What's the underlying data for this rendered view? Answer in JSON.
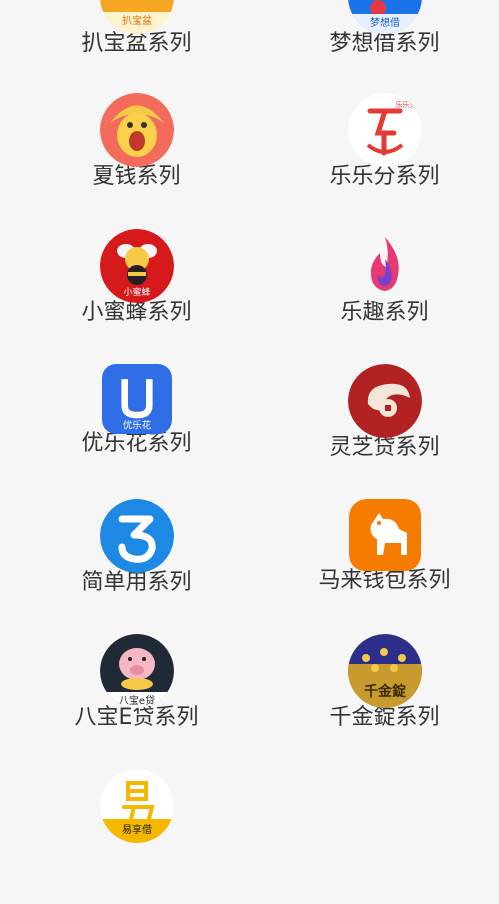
{
  "items": [
    {
      "label": "扒宝盆系列",
      "icon": "pabaopen-logo-icon",
      "icon_text": "扒宝盆"
    },
    {
      "label": "梦想借系列",
      "icon": "mengxiangjie-logo-icon",
      "icon_text": "梦想借"
    },
    {
      "label": "夏钱系列",
      "icon": "xiaqian-logo-icon"
    },
    {
      "label": "乐乐分系列",
      "icon": "lelefen-logo-icon",
      "icon_text": "乐乐分"
    },
    {
      "label": "小蜜蜂系列",
      "icon": "xiaomifeng-logo-icon",
      "icon_text": "小蜜蜂"
    },
    {
      "label": "乐趣系列",
      "icon": "flame-logo-icon"
    },
    {
      "label": "优乐花系列",
      "icon": "youlehua-logo-icon",
      "icon_text": "优乐花"
    },
    {
      "label": "灵芝贷系列",
      "icon": "lingzhidai-logo-icon"
    },
    {
      "label": "简单用系列",
      "icon": "jiandanyong-logo-icon"
    },
    {
      "label": "马来钱包系列",
      "icon": "horse-logo-icon"
    },
    {
      "label": "八宝E贷系列",
      "icon": "pig-logo-icon",
      "icon_text": "八宝e贷"
    },
    {
      "label": "千金錠系列",
      "icon": "qianjinding-logo-icon",
      "icon_text": "千金錠"
    },
    {
      "label": "",
      "icon": "yixiangjie-logo-icon",
      "icon_text": "易享借"
    }
  ],
  "colors": {
    "background": "#f6f6f6",
    "label": "#333333"
  }
}
